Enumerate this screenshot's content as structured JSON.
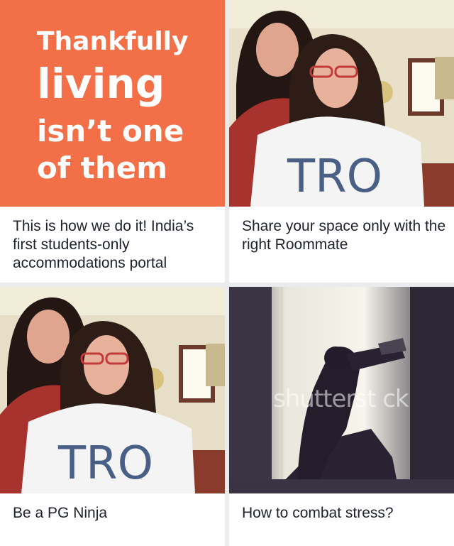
{
  "cards": [
    {
      "caption": "This is how we do it! India’s first students-only accommodations portal",
      "image_text": [
        "Thankfully",
        "living",
        "isn’t one",
        "of them"
      ],
      "image_color": "#f26f48"
    },
    {
      "caption": "Share your space only with the right Roommate",
      "image_text": [
        "TRO"
      ]
    },
    {
      "caption": "Be a PG Ninja",
      "image_text": [
        "TRO"
      ]
    },
    {
      "caption": "How to combat stress?",
      "watermark": "shutterst ck"
    }
  ]
}
